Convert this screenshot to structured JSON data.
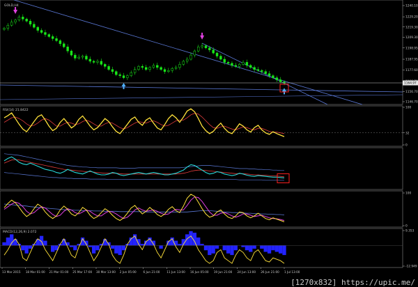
{
  "window": {
    "symbol_label": "GOLD,H4",
    "watermark": "[1270x832] https://upic.me/"
  },
  "colors": {
    "background": "#000000",
    "candle_up": "#19e619",
    "candle_down": "#19e619",
    "trendline": "#5a78d6",
    "axis_text": "#c8c8c8",
    "yellow": "#ffe13a",
    "red_line": "#e03c3c",
    "cyan": "#28d9d9",
    "magenta": "#e040e0",
    "blue_fill": "#2323ff",
    "marker_box": "#ff2020",
    "arrow_up": "#4fb0ff",
    "arrow_down": "#e040e0"
  },
  "icons": {
    "down_arrow": "magenta-down-arrow-icon",
    "up_arrow": "blue-up-arrow-icon"
  },
  "chart_data": [
    {
      "type": "line",
      "panel": "price",
      "title": "GOLD,H4",
      "yticks": [
        "1240.10",
        "1229.20",
        "1219.30",
        "1209.30",
        "1198.95",
        "1187.95",
        "1177.60",
        "1166.70",
        "1156.70",
        "1146.70"
      ],
      "current_price": "1164.97",
      "ylim": [
        1146.7,
        1240.1
      ],
      "close": [
        1218,
        1221,
        1224,
        1226,
        1229,
        1227,
        1225,
        1222,
        1219,
        1216,
        1214,
        1212,
        1210,
        1208,
        1206,
        1203,
        1200,
        1196,
        1192,
        1189,
        1190,
        1191,
        1188,
        1186,
        1185,
        1186,
        1183,
        1181,
        1178,
        1176,
        1173,
        1172,
        1170,
        1172,
        1175,
        1178,
        1181,
        1180,
        1178,
        1180,
        1182,
        1180,
        1178,
        1176,
        1177,
        1179,
        1180,
        1183,
        1186,
        1188,
        1192,
        1196,
        1200,
        1201,
        1199,
        1197,
        1194,
        1191,
        1188,
        1185,
        1184,
        1182,
        1181,
        1183,
        1185,
        1182,
        1180,
        1178,
        1177,
        1176,
        1174,
        1172,
        1170,
        1168,
        1166,
        1165
      ],
      "arrows": [
        {
          "dir": "down",
          "index": 3
        },
        {
          "dir": "up",
          "index": 32
        },
        {
          "dir": "down",
          "index": 53
        },
        {
          "dir": "up",
          "index": 75
        }
      ]
    },
    {
      "type": "line",
      "panel": "rsi",
      "label": "RSI(14) 21.8422",
      "yticks": [
        "100",
        "32",
        "0"
      ],
      "ylim": [
        0,
        100
      ],
      "levels": [
        32
      ],
      "fast": [
        72,
        78,
        85,
        70,
        55,
        42,
        35,
        48,
        62,
        75,
        80,
        66,
        50,
        38,
        44,
        60,
        70,
        58,
        45,
        52,
        68,
        77,
        64,
        50,
        40,
        46,
        58,
        70,
        62,
        48,
        36,
        30,
        42,
        55,
        68,
        74,
        60,
        52,
        66,
        72,
        58,
        45,
        40,
        54,
        70,
        80,
        72,
        60,
        74,
        90,
        96,
        88,
        70,
        50,
        38,
        30,
        36,
        48,
        58,
        44,
        34,
        30,
        42,
        56,
        50,
        40,
        34,
        46,
        52,
        40,
        32,
        28,
        35,
        30,
        26,
        22
      ],
      "slow": [
        60,
        66,
        72,
        74,
        70,
        64,
        56,
        50,
        52,
        58,
        66,
        70,
        66,
        58,
        50,
        50,
        56,
        60,
        58,
        54,
        56,
        62,
        66,
        62,
        56,
        50,
        50,
        56,
        60,
        58,
        52,
        46,
        42,
        46,
        52,
        58,
        62,
        60,
        58,
        62,
        64,
        60,
        54,
        50,
        52,
        58,
        64,
        66,
        66,
        72,
        80,
        84,
        82,
        74,
        64,
        54,
        46,
        44,
        48,
        50,
        46,
        42,
        40,
        44,
        48,
        46,
        42,
        40,
        44,
        44,
        40,
        36,
        34,
        34,
        32,
        30
      ]
    },
    {
      "type": "line",
      "panel": "bands",
      "label": "",
      "ylim": [
        0,
        100
      ],
      "upper": [
        88,
        87,
        86,
        85,
        84,
        82,
        80,
        78,
        76,
        74,
        72,
        70,
        68,
        66,
        64,
        62,
        60,
        58,
        57,
        56,
        55,
        54,
        54,
        53,
        53,
        52,
        52,
        52,
        52,
        52,
        52,
        51,
        51,
        51,
        51,
        51,
        52,
        52,
        52,
        52,
        52,
        52,
        52,
        52,
        52,
        52,
        52,
        52,
        53,
        54,
        55,
        56,
        57,
        58,
        58,
        58,
        57,
        56,
        55,
        54,
        53,
        52,
        51,
        50,
        50,
        50,
        49,
        49,
        48,
        48,
        47,
        47,
        46,
        46,
        45,
        45
      ],
      "lower": [
        40,
        39,
        38,
        37,
        36,
        35,
        34,
        33,
        32,
        31,
        30,
        29,
        28,
        27,
        27,
        26,
        26,
        25,
        25,
        24,
        24,
        24,
        24,
        23,
        23,
        23,
        23,
        23,
        22,
        22,
        22,
        22,
        22,
        22,
        22,
        22,
        22,
        22,
        22,
        22,
        22,
        22,
        22,
        22,
        22,
        22,
        22,
        22,
        22,
        22,
        22,
        22,
        22,
        22,
        22,
        22,
        22,
        22,
        22,
        22,
        22,
        22,
        22,
        21,
        21,
        21,
        21,
        21,
        21,
        21,
        20,
        20,
        20,
        20,
        20,
        20
      ],
      "fast": [
        70,
        76,
        80,
        74,
        66,
        62,
        60,
        64,
        60,
        56,
        52,
        48,
        46,
        44,
        40,
        38,
        42,
        48,
        44,
        40,
        38,
        36,
        40,
        44,
        40,
        36,
        34,
        34,
        36,
        40,
        38,
        34,
        32,
        34,
        36,
        38,
        40,
        38,
        36,
        38,
        40,
        38,
        36,
        34,
        34,
        36,
        38,
        42,
        46,
        54,
        60,
        58,
        52,
        46,
        40,
        36,
        38,
        42,
        40,
        36,
        34,
        32,
        34,
        38,
        36,
        33,
        31,
        30,
        32,
        31,
        30,
        29,
        28,
        28,
        27,
        26
      ],
      "slow": [
        64,
        68,
        72,
        73,
        72,
        70,
        68,
        66,
        64,
        62,
        60,
        58,
        56,
        54,
        52,
        50,
        48,
        47,
        46,
        45,
        44,
        43,
        42,
        42,
        41,
        40,
        39,
        38,
        38,
        38,
        38,
        37,
        36,
        36,
        36,
        36,
        36,
        36,
        36,
        36,
        36,
        36,
        36,
        36,
        36,
        36,
        36,
        37,
        38,
        40,
        43,
        45,
        46,
        46,
        45,
        44,
        43,
        42,
        41,
        40,
        39,
        38,
        37,
        37,
        37,
        36,
        35,
        34,
        34,
        33,
        33,
        32,
        31,
        31,
        30,
        29
      ]
    },
    {
      "type": "line",
      "panel": "stoch",
      "label": "",
      "yticks": [
        "100",
        "0"
      ],
      "ylim": [
        0,
        100
      ],
      "main": [
        55,
        68,
        78,
        70,
        56,
        40,
        28,
        36,
        52,
        66,
        58,
        42,
        30,
        22,
        30,
        48,
        60,
        50,
        36,
        30,
        40,
        56,
        48,
        32,
        22,
        28,
        40,
        52,
        44,
        32,
        22,
        16,
        24,
        38,
        54,
        62,
        48,
        36,
        44,
        56,
        46,
        34,
        28,
        36,
        50,
        58,
        46,
        40,
        60,
        84,
        96,
        90,
        72,
        52,
        36,
        26,
        30,
        42,
        48,
        36,
        26,
        22,
        30,
        42,
        40,
        30,
        24,
        30,
        38,
        30,
        22,
        18,
        24,
        20,
        16,
        12
      ],
      "signal": [
        50,
        58,
        66,
        72,
        68,
        58,
        44,
        36,
        40,
        50,
        58,
        54,
        44,
        34,
        28,
        32,
        44,
        52,
        48,
        40,
        36,
        42,
        48,
        44,
        36,
        30,
        30,
        38,
        44,
        42,
        36,
        28,
        22,
        26,
        36,
        48,
        54,
        48,
        44,
        46,
        48,
        44,
        38,
        34,
        36,
        44,
        50,
        48,
        48,
        62,
        78,
        88,
        86,
        74,
        58,
        42,
        32,
        32,
        38,
        40,
        36,
        30,
        26,
        30,
        36,
        36,
        32,
        28,
        30,
        32,
        28,
        24,
        22,
        21,
        19,
        16
      ],
      "ma": [
        66,
        65,
        64,
        63,
        62,
        61,
        60,
        58,
        57,
        56,
        55,
        54,
        53,
        52,
        51,
        50,
        49,
        48,
        48,
        47,
        47,
        46,
        46,
        46,
        45,
        45,
        45,
        44,
        44,
        44,
        44,
        43,
        43,
        43,
        43,
        43,
        43,
        43,
        42,
        42,
        42,
        42,
        42,
        42,
        42,
        42,
        42,
        42,
        42,
        42,
        43,
        44,
        45,
        46,
        46,
        46,
        45,
        44,
        43,
        42,
        41,
        40,
        40,
        39,
        39,
        38,
        38,
        37,
        37,
        36,
        36,
        35,
        35,
        34,
        34,
        33
      ]
    },
    {
      "type": "bar",
      "panel": "macd",
      "label": "MACD(12,26,9) 2.072",
      "yticks": [
        "9.353",
        "-12.949"
      ],
      "ylim": [
        -12.949,
        9.353
      ],
      "hist": [
        2,
        5,
        7,
        4,
        1,
        -3,
        -5,
        -2,
        1,
        4,
        6,
        3,
        0,
        -4,
        -3,
        1,
        4,
        2,
        -1,
        -3,
        1,
        5,
        3,
        -1,
        -5,
        -3,
        1,
        4,
        2,
        -2,
        -5,
        -6,
        -3,
        1,
        5,
        7,
        4,
        1,
        3,
        5,
        3,
        0,
        -2,
        0,
        3,
        5,
        3,
        1,
        4,
        7,
        9,
        8,
        5,
        1,
        -3,
        -6,
        -5,
        -2,
        0,
        -3,
        -5,
        -6,
        -3,
        0,
        -1,
        -3,
        -4,
        -2,
        0,
        -2,
        -4,
        -5,
        -3,
        -4,
        -5,
        -6
      ],
      "signal": [
        -6,
        -2,
        3,
        6,
        2,
        -8,
        -10,
        -4,
        2,
        6,
        4,
        -2,
        -6,
        -10,
        -4,
        2,
        6,
        0,
        -6,
        -8,
        0,
        6,
        2,
        -4,
        -10,
        -6,
        0,
        6,
        2,
        -6,
        -10,
        -12,
        -6,
        2,
        6,
        8,
        2,
        -2,
        4,
        6,
        2,
        -4,
        -8,
        -2,
        4,
        6,
        0,
        -4,
        2,
        6,
        8,
        4,
        -2,
        -6,
        -10,
        -12,
        -10,
        -4,
        -2,
        -8,
        -10,
        -12,
        -6,
        -2,
        -4,
        -8,
        -10,
        -4,
        -2,
        -6,
        -10,
        -11,
        -8,
        -9,
        -10,
        -12
      ]
    }
  ],
  "xaxis": {
    "labels": [
      "13 Mar 2015",
      "18 Mar 01:00",
      "21 Mar 01:00",
      "25 Mar 17:00",
      "30 Mar 13:00",
      "2 Jun 05:00",
      "6 Jun 21:00",
      "11 Jun 13:00",
      "16 Jun 05:00",
      "19 Jun 21:00",
      "24 Jun 13:00",
      "26 Jun 21:00",
      "1 Jul 13:00"
    ]
  }
}
